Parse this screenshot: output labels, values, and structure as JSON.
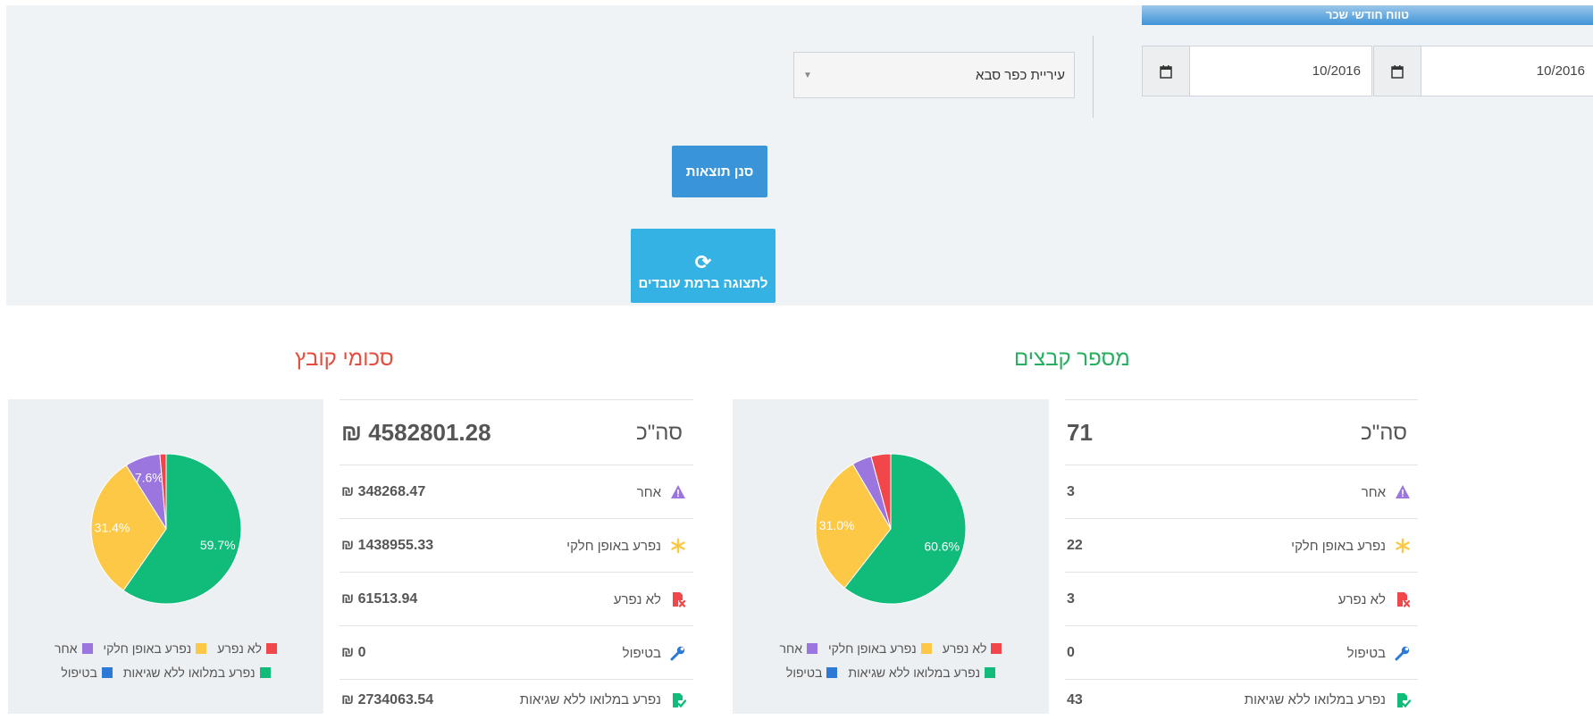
{
  "colors": {
    "done_full": "#11bb7a",
    "partial": "#fcc846",
    "not_done": "#f1464a",
    "other": "#9b76de",
    "in_treatment": "#2c7ad6"
  },
  "filters": {
    "range_title": "טווח חודשי שכר",
    "date_from": "10/2016",
    "date_to": "10/2016",
    "calendar_icon": "calendar-icon",
    "municipality": "עיריית כפר סבא",
    "filter_button": "סנן תוצאות",
    "employees_button": "לתצוגה ברמת עובדים"
  },
  "files_count": {
    "title": "מספר קבצים",
    "total_label": "סה\"כ",
    "total_value": "71",
    "rows": [
      {
        "label": "אחר",
        "value": "3",
        "icon": "warning-triangle-icon"
      },
      {
        "label": "נפרע באופן חלקי",
        "value": "22",
        "icon": "asterisk-icon"
      },
      {
        "label": "לא נפרע",
        "value": "3",
        "icon": "file-x-icon"
      },
      {
        "label": "בטיפול",
        "value": "0",
        "icon": "wrench-icon"
      },
      {
        "label": "נפרע במלואו ללא שגיאות",
        "value": "43",
        "icon": "file-check-icon"
      }
    ]
  },
  "file_sums": {
    "title": "סכומי קובץ",
    "total_label": "סה\"כ",
    "total_value": "₪ 4582801.28",
    "rows": [
      {
        "label": "אחר",
        "value": "₪ 348268.47",
        "icon": "warning-triangle-icon"
      },
      {
        "label": "נפרע באופן חלקי",
        "value": "₪ 1438955.33",
        "icon": "asterisk-icon"
      },
      {
        "label": "לא נפרע",
        "value": "₪ 61513.94",
        "icon": "file-x-icon"
      },
      {
        "label": "בטיפול",
        "value": "₪ 0",
        "icon": "wrench-icon"
      },
      {
        "label": "נפרע במלואו ללא שגיאות",
        "value": "₪ 2734063.54",
        "icon": "file-check-icon"
      }
    ]
  },
  "chart_data": [
    {
      "type": "pie",
      "series": [
        {
          "name": "נפרע במלואו ללא שגיאות",
          "value": 43,
          "label": "60.6%",
          "color": "#11bb7a"
        },
        {
          "name": "נפרע באופן חלקי",
          "value": 22,
          "label": "31.0%",
          "color": "#fcc846"
        },
        {
          "name": "אחר",
          "value": 3,
          "label": "",
          "color": "#9b76de"
        },
        {
          "name": "לא נפרע",
          "value": 3,
          "label": "",
          "color": "#f1464a"
        },
        {
          "name": "בטיפול",
          "value": 0,
          "label": "",
          "color": "#2c7ad6"
        }
      ],
      "legend": [
        {
          "name": "לא נפרע",
          "color": "#f1464a"
        },
        {
          "name": "נפרע באופן חלקי",
          "color": "#fcc846"
        },
        {
          "name": "אחר",
          "color": "#9b76de"
        },
        {
          "name": "נפרע במלואו ללא שגיאות",
          "color": "#11bb7a"
        },
        {
          "name": "בטיפול",
          "color": "#2c7ad6"
        }
      ]
    },
    {
      "type": "pie",
      "series": [
        {
          "name": "נפרע במלואו ללא שגיאות",
          "value": 2734063.54,
          "label": "59.7%",
          "color": "#11bb7a"
        },
        {
          "name": "נפרע באופן חלקי",
          "value": 1438955.33,
          "label": "31.4%",
          "color": "#fcc846"
        },
        {
          "name": "אחר",
          "value": 348268.47,
          "label": "7.6%",
          "color": "#9b76de"
        },
        {
          "name": "לא נפרע",
          "value": 61513.94,
          "label": "",
          "color": "#f1464a"
        },
        {
          "name": "בטיפול",
          "value": 0,
          "label": "",
          "color": "#2c7ad6"
        }
      ],
      "legend": [
        {
          "name": "לא נפרע",
          "color": "#f1464a"
        },
        {
          "name": "נפרע באופן חלקי",
          "color": "#fcc846"
        },
        {
          "name": "אחר",
          "color": "#9b76de"
        },
        {
          "name": "נפרע במלואו ללא שגיאות",
          "color": "#11bb7a"
        },
        {
          "name": "בטיפול",
          "color": "#2c7ad6"
        }
      ]
    }
  ]
}
